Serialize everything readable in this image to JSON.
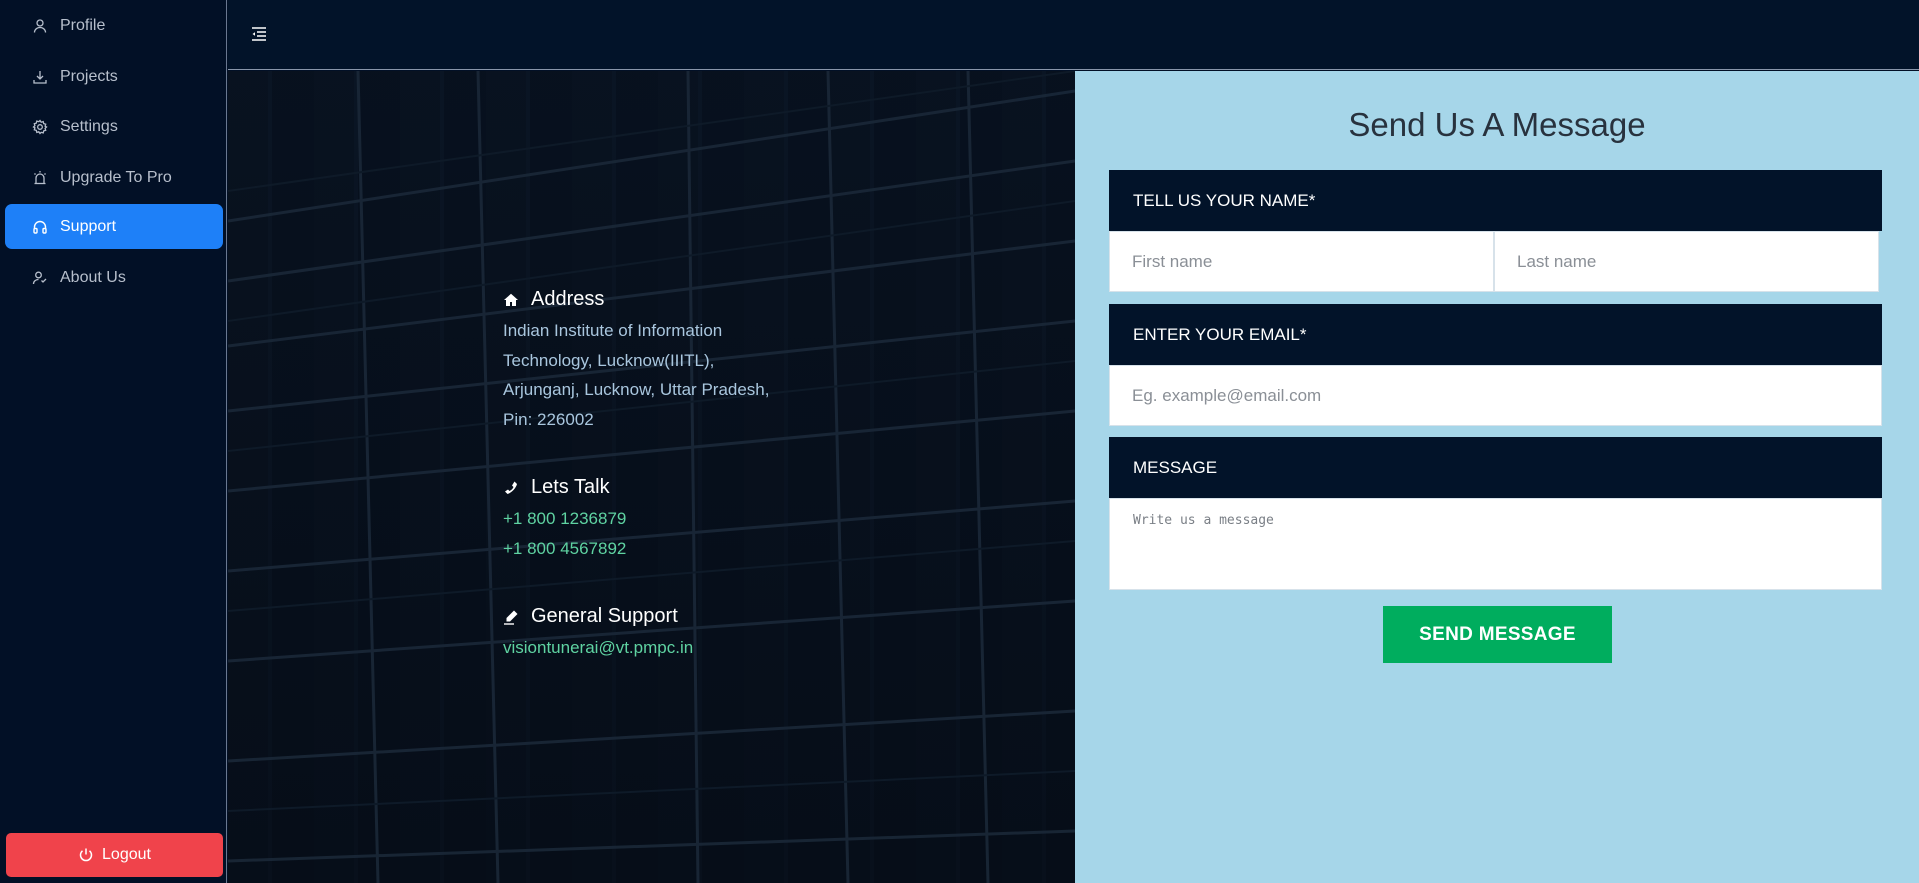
{
  "sidebar": {
    "items": [
      {
        "label": "Profile",
        "icon": "user-icon"
      },
      {
        "label": "Projects",
        "icon": "download-icon"
      },
      {
        "label": "Settings",
        "icon": "gear-icon"
      },
      {
        "label": "Upgrade To Pro",
        "icon": "alarm-icon"
      },
      {
        "label": "Support",
        "icon": "headphones-icon",
        "active": true
      },
      {
        "label": "About Us",
        "icon": "users-icon"
      }
    ],
    "logout_label": "Logout",
    "active_color": "#1e80f8",
    "logout_color": "#f0434b"
  },
  "topbar": {
    "toggle_icon": "menu-indent-icon"
  },
  "contact": {
    "address": {
      "title": "Address",
      "lines": [
        "Indian Institute of Information",
        "Technology, Lucknow(IIITL),",
        "Arjunganj, Lucknow, Uttar Pradesh,",
        "Pin: 226002"
      ]
    },
    "talk": {
      "title": "Lets Talk",
      "phones": [
        "+1 800 1236879",
        "+1 800 4567892"
      ]
    },
    "support": {
      "title": "General Support",
      "email": "visiontunerai@vt.pmpc.in"
    },
    "link_color": "#5fd3a2"
  },
  "form": {
    "title": "Send Us A Message",
    "name_label": "TELL US YOUR NAME*",
    "first_name_placeholder": "First name",
    "last_name_placeholder": "Last name",
    "email_label": "ENTER YOUR EMAIL*",
    "email_placeholder": "Eg. example@email.com",
    "message_label": "MESSAGE",
    "message_placeholder": "Write us a message",
    "send_label": "SEND MESSAGE",
    "send_color": "#00ad5e",
    "background": "#a6d6e9"
  }
}
